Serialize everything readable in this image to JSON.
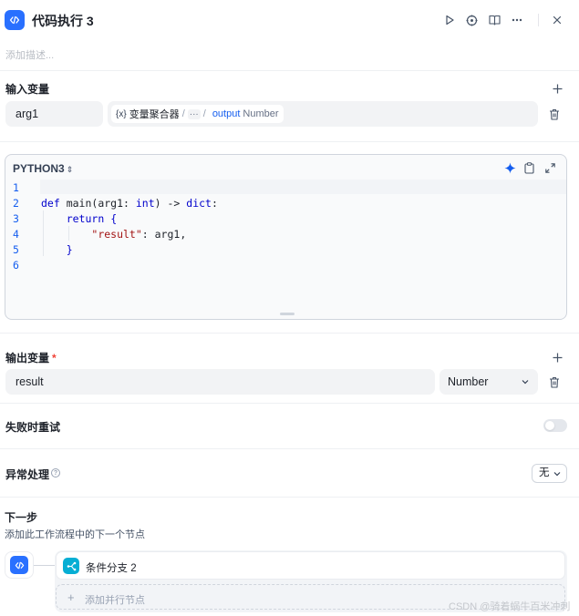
{
  "header": {
    "title": "代码执行 3",
    "description_placeholder": "添加描述..."
  },
  "input_section": {
    "title": "输入变量",
    "variables": [
      {
        "name": "arg1",
        "ref_symbol": "{x}",
        "ref_node": "变量聚合器",
        "ref_sep": "/",
        "ref_ellipsis": "···",
        "ref_sep2": "/",
        "ref_output": "output",
        "ref_type": "Number"
      }
    ]
  },
  "code_section": {
    "language": "PYTHON3",
    "line_numbers": [
      "1",
      "2",
      "3",
      "4",
      "5",
      "6"
    ]
  },
  "output_section": {
    "title": "输出变量",
    "required_mark": "*",
    "variables": [
      {
        "name": "result",
        "type": "Number"
      }
    ]
  },
  "retry": {
    "label": "失败时重试",
    "enabled": false
  },
  "error_handling": {
    "label": "异常处理",
    "value": "无"
  },
  "next_step": {
    "title": "下一步",
    "subtitle": "添加此工作流程中的下一个节点",
    "nodes": [
      {
        "label": "条件分支 2"
      }
    ],
    "add_parallel_label": "添加并行节点"
  },
  "watermark": "CSDN @骑着蜗牛百米冲刺",
  "colors": {
    "accent": "#2970ff",
    "branch": "#06aed4",
    "link": "#155eef"
  },
  "icons": [
    "code-icon",
    "play-icon",
    "target-icon",
    "book-icon",
    "more-icon",
    "close-icon",
    "plus-icon",
    "trash-icon",
    "sparkle-icon",
    "clipboard-icon",
    "expand-icon",
    "chevron-down-icon",
    "branch-icon"
  ]
}
